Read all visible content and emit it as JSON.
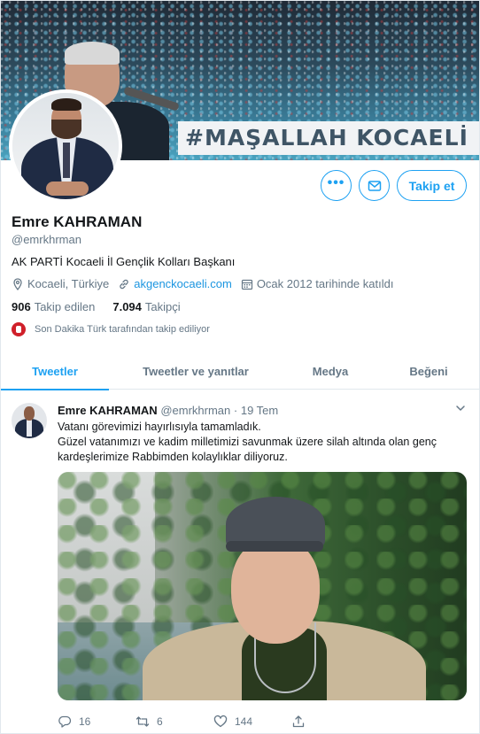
{
  "banner": {
    "sign_text": "#MAŞALLAH KOCAELİ"
  },
  "actions": {
    "more_label": "•••",
    "follow_label": "Takip et"
  },
  "profile": {
    "name": "Emre KAHRAMAN",
    "handle": "@emrkhrman",
    "bio": "AK PARTİ Kocaeli İl Gençlik Kolları Başkanı",
    "location": "Kocaeli, Türkiye",
    "website": "akgenckocaeli.com",
    "joined": "Ocak 2012 tarihinde katıldı",
    "following_count": "906",
    "following_label": "Takip edilen",
    "followers_count": "7.094",
    "followers_label": "Takipçi",
    "followed_by": "Son Dakika Türk tarafından takip ediliyor"
  },
  "tabs": [
    {
      "label": "Tweetler",
      "active": true
    },
    {
      "label": "Tweetler ve yanıtlar",
      "active": false
    },
    {
      "label": "Medya",
      "active": false
    },
    {
      "label": "Beğeni",
      "active": false
    }
  ],
  "tweet": {
    "author_name": "Emre KAHRAMAN",
    "author_handle": "@emrkhrman",
    "separator": "·",
    "date": "19 Tem",
    "text_line1": "Vatanı görevimizi hayırlısıyla tamamladık.",
    "text_line2": "Güzel vatanımızı ve kadim milletimizi savunmak üzere silah altında olan genç kardeşlerimize Rabbimden kolaylıklar diliyoruz.",
    "replies": "16",
    "retweets": "6",
    "likes": "144"
  },
  "colors": {
    "accent": "#1da1f2",
    "text_secondary": "#657786",
    "link": "#1b95e0"
  }
}
